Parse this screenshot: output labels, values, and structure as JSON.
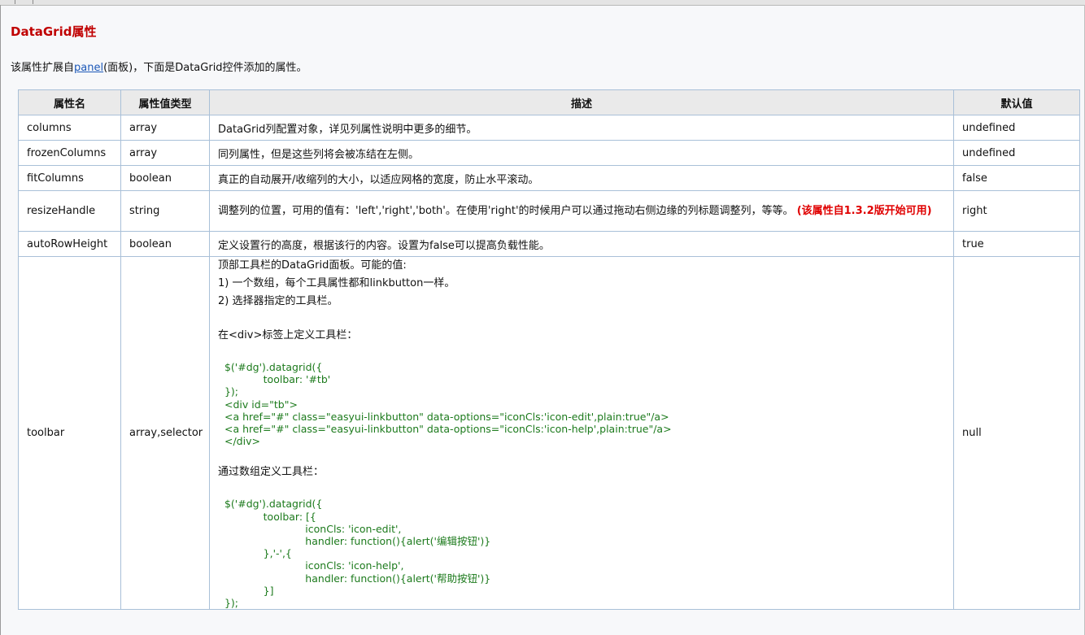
{
  "heading": "DataGrid属性",
  "intro": {
    "prefix": "该属性扩展自",
    "link": "panel",
    "suffix": "(面板)，下面是DataGrid控件添加的属性。"
  },
  "table": {
    "headers": [
      "属性名",
      "属性值类型",
      "描述",
      "默认值"
    ],
    "rows": [
      {
        "name": "columns",
        "type": "array",
        "desc": "DataGrid列配置对象，详见列属性说明中更多的细节。",
        "default": "undefined"
      },
      {
        "name": "frozenColumns",
        "type": "array",
        "desc": "同列属性，但是这些列将会被冻结在左侧。",
        "default": "undefined"
      },
      {
        "name": "fitColumns",
        "type": "boolean",
        "desc": "真正的自动展开/收缩列的大小，以适应网格的宽度，防止水平滚动。",
        "default": "false"
      },
      {
        "name": "resizeHandle",
        "type": "string",
        "desc": "调整列的位置，可用的值有：'left','right','both'。在使用'right'的时候用户可以通过拖动右侧边缘的列标题调整列，等等。",
        "note": "(该属性自1.3.2版开始可用)",
        "default": "right"
      },
      {
        "name": "autoRowHeight",
        "type": "boolean",
        "desc": "定义设置行的高度，根据该行的内容。设置为false可以提高负载性能。",
        "default": "true"
      }
    ],
    "toolbar_row": {
      "name": "toolbar",
      "type": "array,selector",
      "default": "null",
      "desc_lines": [
        "顶部工具栏的DataGrid面板。可能的值:",
        "1) 一个数组，每个工具属性都和linkbutton一样。",
        "2) 选择器指定的工具栏。"
      ],
      "div_heading": "在<div>标签上定义工具栏：",
      "code_div": " $('#dg').datagrid({\n             toolbar: '#tb'\n });\n <div id=\"tb\">\n <a href=\"#\" class=\"easyui-linkbutton\" data-options=\"iconCls:'icon-edit',plain:true\"/a>\n <a href=\"#\" class=\"easyui-linkbutton\" data-options=\"iconCls:'icon-help',plain:true\"/a>\n </div>",
      "array_heading": "通过数组定义工具栏：",
      "code_array": " $('#dg').datagrid({\n             toolbar: [{\n                          iconCls: 'icon-edit',\n                          handler: function(){alert('编辑按钮')}\n             },'-',{\n                          iconCls: 'icon-help',\n                          handler: function(){alert('帮助按钮')}\n             }]\n });"
    }
  }
}
